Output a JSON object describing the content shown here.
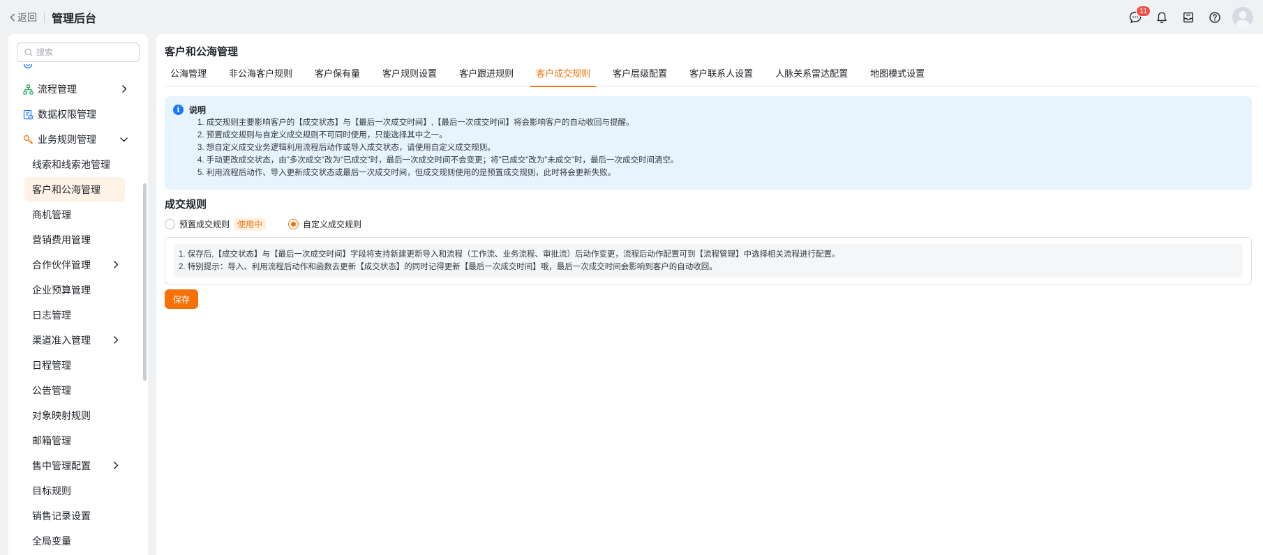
{
  "topbar": {
    "back_label": "返回",
    "app_title": "管理后台",
    "chat_badge": "11"
  },
  "sidebar": {
    "search_placeholder": "搜索",
    "items": [
      {
        "label": "流程管理",
        "level": "top",
        "icon": "flow-icon",
        "expandable": true,
        "expanded": false
      },
      {
        "label": "数据权限管理",
        "level": "top",
        "icon": "data-permission-icon",
        "expandable": false
      },
      {
        "label": "业务规则管理",
        "level": "top",
        "icon": "business-rule-icon",
        "expandable": true,
        "expanded": true
      },
      {
        "label": "线索和线索池管理",
        "level": "sub"
      },
      {
        "label": "客户和公海管理",
        "level": "sub",
        "active": true
      },
      {
        "label": "商机管理",
        "level": "sub"
      },
      {
        "label": "营销费用管理",
        "level": "sub"
      },
      {
        "label": "合作伙伴管理",
        "level": "sub",
        "expandable": true
      },
      {
        "label": "企业预算管理",
        "level": "sub"
      },
      {
        "label": "日志管理",
        "level": "sub"
      },
      {
        "label": "渠道准入管理",
        "level": "sub",
        "expandable": true
      },
      {
        "label": "日程管理",
        "level": "sub"
      },
      {
        "label": "公告管理",
        "level": "sub"
      },
      {
        "label": "对象映射规则",
        "level": "sub"
      },
      {
        "label": "邮箱管理",
        "level": "sub"
      },
      {
        "label": "售中管理配置",
        "level": "sub",
        "expandable": true
      },
      {
        "label": "目标规则",
        "level": "sub"
      },
      {
        "label": "销售记录设置",
        "level": "sub"
      },
      {
        "label": "全局变量",
        "level": "sub"
      }
    ]
  },
  "main": {
    "page_title": "客户和公海管理",
    "tabs": [
      {
        "label": "公海管理"
      },
      {
        "label": "非公海客户规则"
      },
      {
        "label": "客户保有量"
      },
      {
        "label": "客户规则设置"
      },
      {
        "label": "客户跟进规则"
      },
      {
        "label": "客户成交规则",
        "active": true
      },
      {
        "label": "客户层级配置"
      },
      {
        "label": "客户联系人设置"
      },
      {
        "label": "人脉关系雷达配置"
      },
      {
        "label": "地图模式设置"
      }
    ],
    "info": {
      "title": "说明",
      "lines": [
        "1. 成交规则主要影响客户的【成交状态】与【最后一次成交时间】,【最后一次成交时间】将会影响客户的自动收回与提醒。",
        "2. 预置成交规则与自定义成交规则不可同时使用，只能选择其中之一。",
        "3. 想自定义成交业务逻辑利用流程后动作或导入成交状态，请使用自定义成交规则。",
        "4. 手动更改成交状态，由\"多次成交\"改为\"已成交\"时，最后一次成交时间不会变更；将\"已成交\"改为\"未成交\"时，最后一次成交时间清空。",
        "5. 利用流程后动作、导入更新成交状态或最后一次成交时间，但成交规则使用的是预置成交规则，此时将会更新失败。"
      ]
    },
    "section_title": "成交规则",
    "radio_preset": {
      "label": "预置成交规则",
      "tag": "使用中",
      "selected": false
    },
    "radio_custom": {
      "label": "自定义成交规则",
      "selected": true
    },
    "rule_lines": [
      "1. 保存后,【成交状态】与【最后一次成交时间】字段将支持新建更新导入和流程（工作流、业务流程、审批流）后动作变更，流程后动作配置可到【流程管理】中选择相关流程进行配置。",
      "2. 特别提示：导入、利用流程后动作和函数去更新【成交状态】的同时记得更新【最后一次成交时间】哦，最后一次成交时间会影响到客户的自动收回。"
    ],
    "save_label": "保存"
  },
  "colors": {
    "accent": "#f5720a",
    "info_bg": "#e7f3fd",
    "info_icon": "#1677ff",
    "badge": "#f54a45"
  }
}
